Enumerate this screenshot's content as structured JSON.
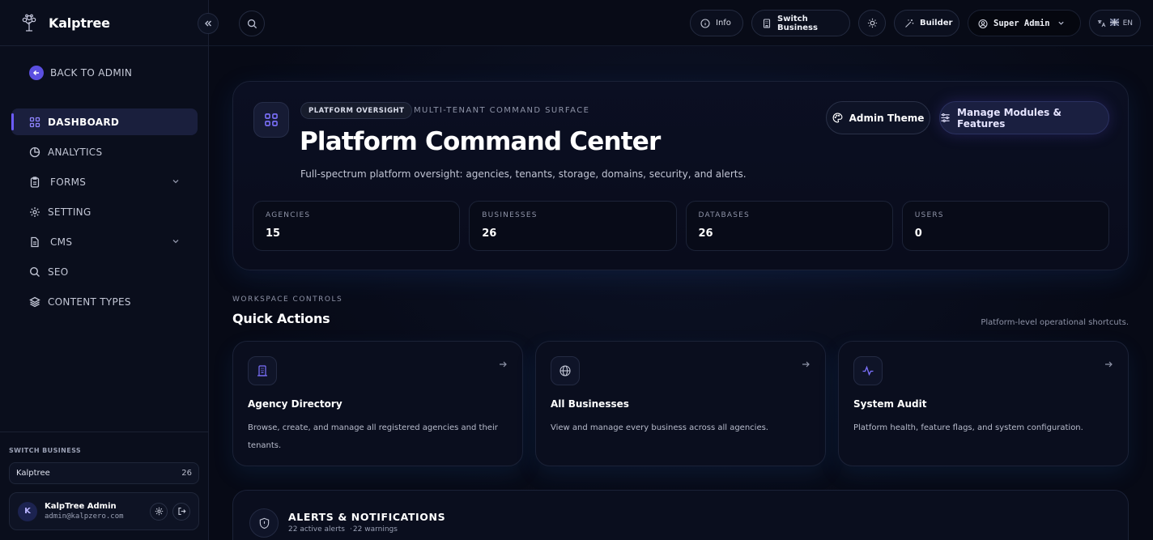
{
  "brand": {
    "name": "Kalptree"
  },
  "sidebar": {
    "back_label": "BACK TO ADMIN",
    "items": [
      {
        "label": "DASHBOARD",
        "icon": "grid-icon",
        "active": true
      },
      {
        "label": "ANALYTICS",
        "icon": "pie-chart-icon"
      },
      {
        "label": "FORMS",
        "icon": "clipboard-icon",
        "has_children": true
      },
      {
        "label": "SETTING",
        "icon": "gear-icon"
      },
      {
        "label": "CMS",
        "icon": "file-text-icon",
        "has_children": true
      },
      {
        "label": "SEO",
        "icon": "search-icon"
      },
      {
        "label": "CONTENT TYPES",
        "icon": "layers-icon"
      }
    ],
    "switch_business": {
      "label": "SWITCH BUSINESS",
      "selected": "Kalptree",
      "count": "26"
    },
    "user": {
      "initial": "K",
      "name": "KalpTree Admin",
      "email": "admin@kalpzero.com"
    }
  },
  "topbar": {
    "info_label": "Info",
    "switch_business_label": "Switch Business",
    "builder_label": "Builder",
    "role_label": "Super Admin",
    "lang_label": "EN"
  },
  "hero": {
    "badge": "PLATFORM OVERSIGHT",
    "eyebrow": "MULTI-TENANT COMMAND SURFACE",
    "title": "Platform Command Center",
    "subtitle": "Full-spectrum platform oversight: agencies, tenants, storage, domains, security, and alerts.",
    "admin_theme_label": "Admin Theme",
    "manage_modules_label": "Manage Modules & Features",
    "stats": [
      {
        "label": "AGENCIES",
        "value": "15"
      },
      {
        "label": "BUSINESSES",
        "value": "26"
      },
      {
        "label": "DATABASES",
        "value": "26"
      },
      {
        "label": "USERS",
        "value": "0"
      }
    ]
  },
  "workspace": {
    "eyebrow": "WORKSPACE CONTROLS",
    "title": "Quick Actions",
    "hint": "Platform-level operational shortcuts.",
    "cards": [
      {
        "title": "Agency Directory",
        "description": "Browse, create, and manage all registered agencies and their tenants.",
        "icon": "building-icon"
      },
      {
        "title": "All Businesses",
        "description": "View and manage every business across all agencies.",
        "icon": "globe-icon"
      },
      {
        "title": "System Audit",
        "description": "Platform health, feature flags, and system configuration.",
        "icon": "activity-icon"
      }
    ]
  },
  "alerts": {
    "title": "ALERTS & NOTIFICATIONS",
    "active": "22 active alerts",
    "separator": "·",
    "warnings": "22 warnings"
  },
  "colors": {
    "accent": "#6c5cff",
    "background": "#070a16",
    "sidebar": "#0a0e1c"
  }
}
